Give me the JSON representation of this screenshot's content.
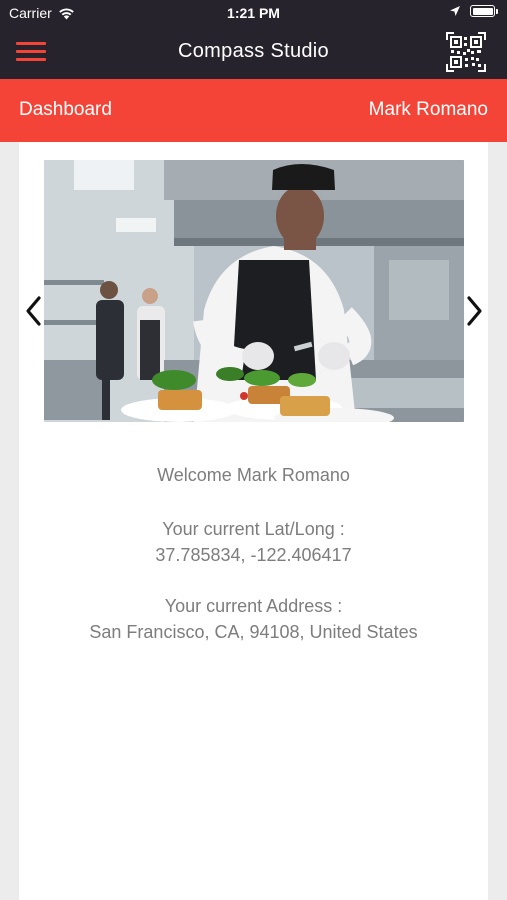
{
  "status_bar": {
    "carrier": "Carrier",
    "time": "1:21 PM",
    "icons": [
      "wifi-icon",
      "location-arrow-icon",
      "battery-icon"
    ]
  },
  "nav": {
    "title": "Compass Studio",
    "menu_icon": "hamburger-menu-icon",
    "qr_icon": "qr-code-icon"
  },
  "subheader": {
    "left_label": "Dashboard",
    "right_label": "Mark Romano"
  },
  "carousel": {
    "image": "chef-plating-food-photo",
    "prev_icon": "chevron-left-icon",
    "next_icon": "chevron-right-icon"
  },
  "main": {
    "welcome": "Welcome Mark Romano",
    "latlong_label": "Your current Lat/Long :",
    "latlong_value": "37.785834, -122.406417",
    "address_label": "Your current Address :",
    "address_value": "San Francisco, CA, 94108, United States"
  },
  "colors": {
    "nav_bg": "#26232d",
    "accent": "#f44437",
    "page_bg": "#ececec",
    "card_bg": "#ffffff",
    "text_muted": "#7d7d7d"
  }
}
